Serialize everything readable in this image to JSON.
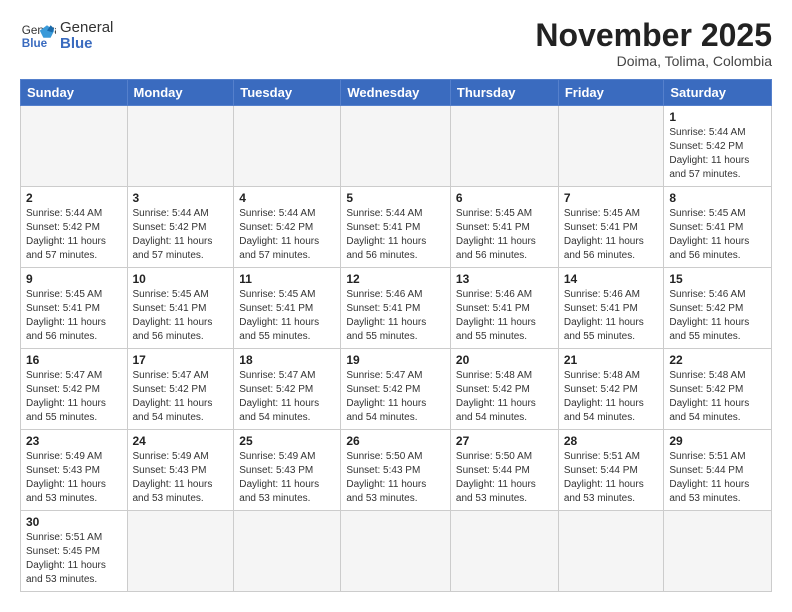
{
  "header": {
    "logo_general": "General",
    "logo_blue": "Blue",
    "month_title": "November 2025",
    "subtitle": "Doima, Tolima, Colombia"
  },
  "weekdays": [
    "Sunday",
    "Monday",
    "Tuesday",
    "Wednesday",
    "Thursday",
    "Friday",
    "Saturday"
  ],
  "weeks": [
    [
      {
        "day": "",
        "info": ""
      },
      {
        "day": "",
        "info": ""
      },
      {
        "day": "",
        "info": ""
      },
      {
        "day": "",
        "info": ""
      },
      {
        "day": "",
        "info": ""
      },
      {
        "day": "",
        "info": ""
      },
      {
        "day": "1",
        "info": "Sunrise: 5:44 AM\nSunset: 5:42 PM\nDaylight: 11 hours\nand 57 minutes."
      }
    ],
    [
      {
        "day": "2",
        "info": "Sunrise: 5:44 AM\nSunset: 5:42 PM\nDaylight: 11 hours\nand 57 minutes."
      },
      {
        "day": "3",
        "info": "Sunrise: 5:44 AM\nSunset: 5:42 PM\nDaylight: 11 hours\nand 57 minutes."
      },
      {
        "day": "4",
        "info": "Sunrise: 5:44 AM\nSunset: 5:42 PM\nDaylight: 11 hours\nand 57 minutes."
      },
      {
        "day": "5",
        "info": "Sunrise: 5:44 AM\nSunset: 5:41 PM\nDaylight: 11 hours\nand 56 minutes."
      },
      {
        "day": "6",
        "info": "Sunrise: 5:45 AM\nSunset: 5:41 PM\nDaylight: 11 hours\nand 56 minutes."
      },
      {
        "day": "7",
        "info": "Sunrise: 5:45 AM\nSunset: 5:41 PM\nDaylight: 11 hours\nand 56 minutes."
      },
      {
        "day": "8",
        "info": "Sunrise: 5:45 AM\nSunset: 5:41 PM\nDaylight: 11 hours\nand 56 minutes."
      }
    ],
    [
      {
        "day": "9",
        "info": "Sunrise: 5:45 AM\nSunset: 5:41 PM\nDaylight: 11 hours\nand 56 minutes."
      },
      {
        "day": "10",
        "info": "Sunrise: 5:45 AM\nSunset: 5:41 PM\nDaylight: 11 hours\nand 56 minutes."
      },
      {
        "day": "11",
        "info": "Sunrise: 5:45 AM\nSunset: 5:41 PM\nDaylight: 11 hours\nand 55 minutes."
      },
      {
        "day": "12",
        "info": "Sunrise: 5:46 AM\nSunset: 5:41 PM\nDaylight: 11 hours\nand 55 minutes."
      },
      {
        "day": "13",
        "info": "Sunrise: 5:46 AM\nSunset: 5:41 PM\nDaylight: 11 hours\nand 55 minutes."
      },
      {
        "day": "14",
        "info": "Sunrise: 5:46 AM\nSunset: 5:41 PM\nDaylight: 11 hours\nand 55 minutes."
      },
      {
        "day": "15",
        "info": "Sunrise: 5:46 AM\nSunset: 5:42 PM\nDaylight: 11 hours\nand 55 minutes."
      }
    ],
    [
      {
        "day": "16",
        "info": "Sunrise: 5:47 AM\nSunset: 5:42 PM\nDaylight: 11 hours\nand 55 minutes."
      },
      {
        "day": "17",
        "info": "Sunrise: 5:47 AM\nSunset: 5:42 PM\nDaylight: 11 hours\nand 54 minutes."
      },
      {
        "day": "18",
        "info": "Sunrise: 5:47 AM\nSunset: 5:42 PM\nDaylight: 11 hours\nand 54 minutes."
      },
      {
        "day": "19",
        "info": "Sunrise: 5:47 AM\nSunset: 5:42 PM\nDaylight: 11 hours\nand 54 minutes."
      },
      {
        "day": "20",
        "info": "Sunrise: 5:48 AM\nSunset: 5:42 PM\nDaylight: 11 hours\nand 54 minutes."
      },
      {
        "day": "21",
        "info": "Sunrise: 5:48 AM\nSunset: 5:42 PM\nDaylight: 11 hours\nand 54 minutes."
      },
      {
        "day": "22",
        "info": "Sunrise: 5:48 AM\nSunset: 5:42 PM\nDaylight: 11 hours\nand 54 minutes."
      }
    ],
    [
      {
        "day": "23",
        "info": "Sunrise: 5:49 AM\nSunset: 5:43 PM\nDaylight: 11 hours\nand 53 minutes."
      },
      {
        "day": "24",
        "info": "Sunrise: 5:49 AM\nSunset: 5:43 PM\nDaylight: 11 hours\nand 53 minutes."
      },
      {
        "day": "25",
        "info": "Sunrise: 5:49 AM\nSunset: 5:43 PM\nDaylight: 11 hours\nand 53 minutes."
      },
      {
        "day": "26",
        "info": "Sunrise: 5:50 AM\nSunset: 5:43 PM\nDaylight: 11 hours\nand 53 minutes."
      },
      {
        "day": "27",
        "info": "Sunrise: 5:50 AM\nSunset: 5:44 PM\nDaylight: 11 hours\nand 53 minutes."
      },
      {
        "day": "28",
        "info": "Sunrise: 5:51 AM\nSunset: 5:44 PM\nDaylight: 11 hours\nand 53 minutes."
      },
      {
        "day": "29",
        "info": "Sunrise: 5:51 AM\nSunset: 5:44 PM\nDaylight: 11 hours\nand 53 minutes."
      }
    ],
    [
      {
        "day": "30",
        "info": "Sunrise: 5:51 AM\nSunset: 5:45 PM\nDaylight: 11 hours\nand 53 minutes."
      },
      {
        "day": "",
        "info": ""
      },
      {
        "day": "",
        "info": ""
      },
      {
        "day": "",
        "info": ""
      },
      {
        "day": "",
        "info": ""
      },
      {
        "day": "",
        "info": ""
      },
      {
        "day": "",
        "info": ""
      }
    ]
  ]
}
